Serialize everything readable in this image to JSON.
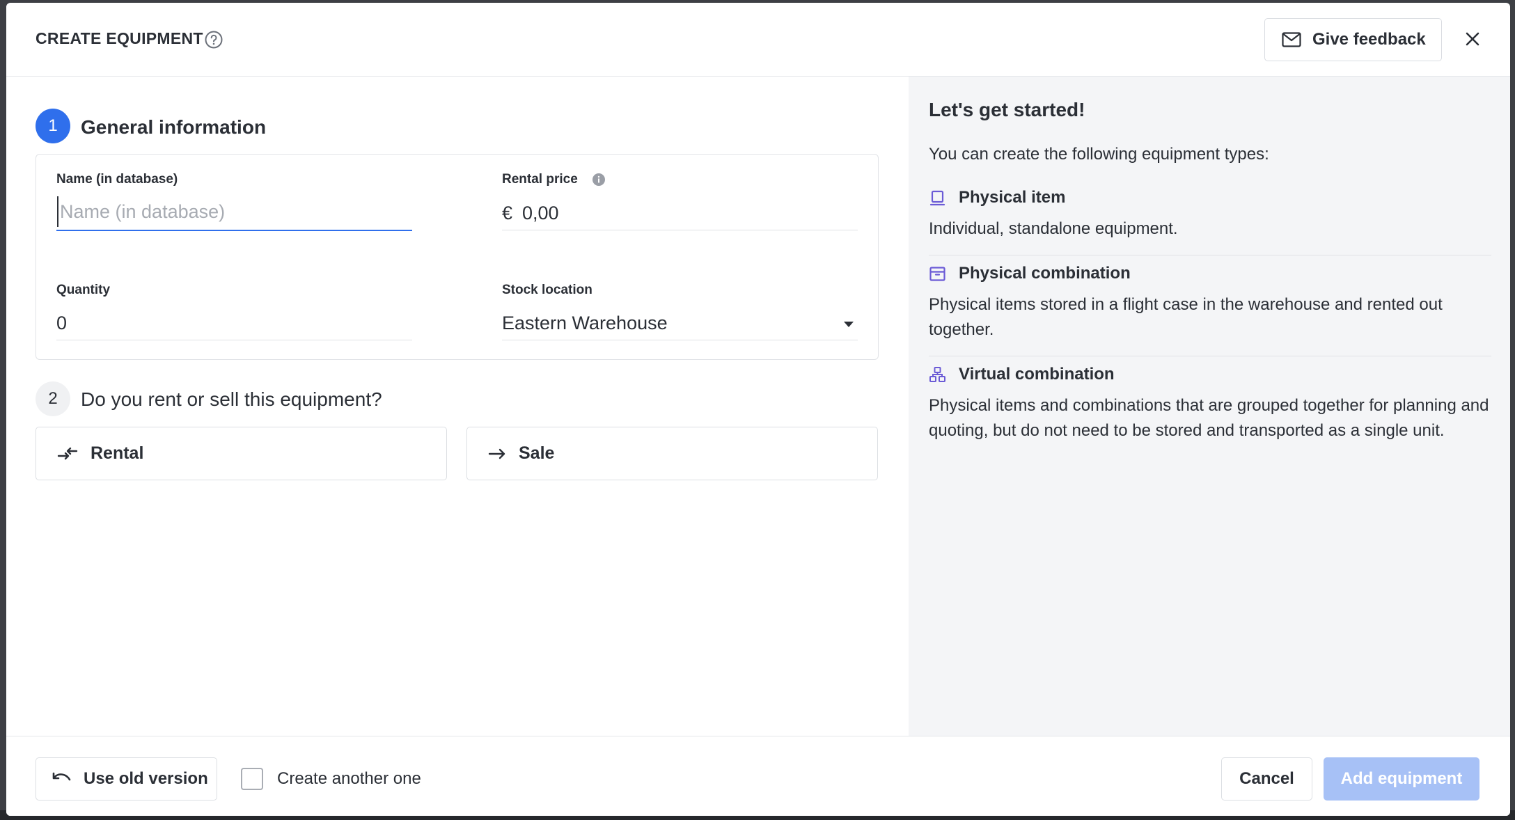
{
  "header": {
    "title": "CREATE EQUIPMENT",
    "help_icon": "help-circle-icon",
    "feedback_label": "Give feedback",
    "feedback_icon": "mail-icon",
    "close_icon": "close-icon"
  },
  "steps": [
    {
      "number": "1",
      "title": "General information"
    },
    {
      "number": "2",
      "title": "Do you rent or sell this equipment?"
    }
  ],
  "general": {
    "name": {
      "label": "Name (in database)",
      "placeholder": "Name (in database)",
      "value": ""
    },
    "rental_price": {
      "label": "Rental price",
      "currency": "€",
      "value": "0,00",
      "info_icon": "info-icon"
    },
    "quantity": {
      "label": "Quantity",
      "value": "0"
    },
    "stock_location": {
      "label": "Stock location",
      "value": "Eastern Warehouse",
      "caret_icon": "caret-down-icon"
    }
  },
  "choices": [
    {
      "label": "Rental",
      "icon": "swap-arrows-icon"
    },
    {
      "label": "Sale",
      "icon": "arrow-right-icon"
    }
  ],
  "sidebar": {
    "heading": "Let's get started!",
    "intro": "You can create the following equipment types:",
    "types": [
      {
        "title": "Physical item",
        "icon": "physical-item-icon",
        "description": "Individual, standalone equipment."
      },
      {
        "title": "Physical combination",
        "icon": "physical-combination-icon",
        "description": "Physical items stored in a flight case in the warehouse and rented out together."
      },
      {
        "title": "Virtual combination",
        "icon": "virtual-combination-icon",
        "description": "Physical items and combinations that are grouped together for planning and quoting, but do not need to be stored and transported as a single unit."
      }
    ]
  },
  "footer": {
    "old_version_label": "Use old version",
    "old_version_icon": "undo-icon",
    "create_another_label": "Create another one",
    "create_another_checked": false,
    "cancel_label": "Cancel",
    "add_label": "Add equipment"
  },
  "colors": {
    "accent": "#2f6fec",
    "accent_disabled": "#a7c1f6",
    "icon_purple": "#6b5bd6",
    "sidebar_bg": "#f4f5f7"
  }
}
